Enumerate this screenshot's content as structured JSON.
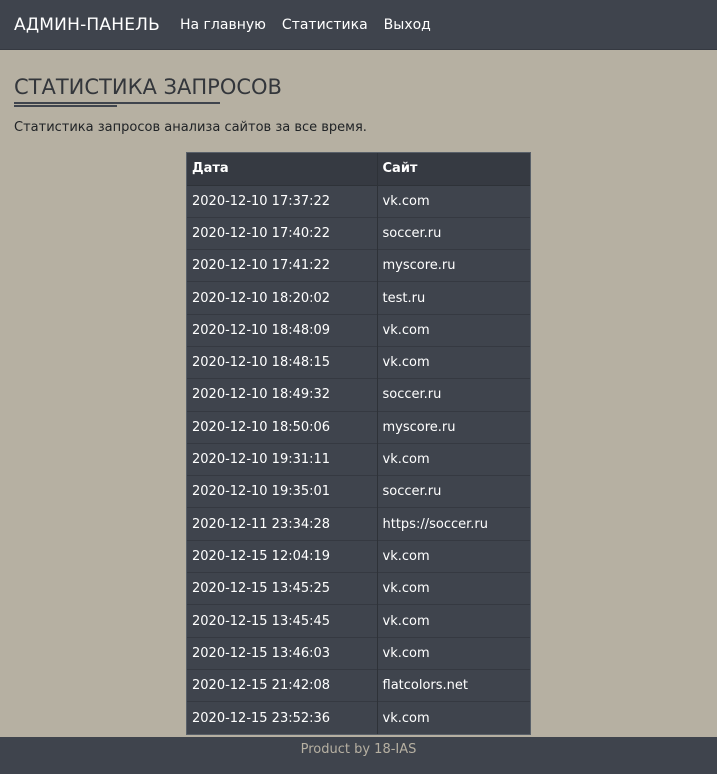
{
  "navbar": {
    "brand": "АДМИН-ПАНЕЛЬ",
    "links": [
      "На главную",
      "Статистика",
      "Выход"
    ]
  },
  "page": {
    "title": "СТАТИСТИКА ЗАПРОСОВ",
    "description": "Статистика запросов анализа сайтов за все время."
  },
  "table": {
    "headers": [
      "Дата",
      "Сайт"
    ],
    "rows": [
      [
        "2020-12-10 17:37:22",
        "vk.com"
      ],
      [
        "2020-12-10 17:40:22",
        "soccer.ru"
      ],
      [
        "2020-12-10 17:41:22",
        "myscore.ru"
      ],
      [
        "2020-12-10 18:20:02",
        "test.ru"
      ],
      [
        "2020-12-10 18:48:09",
        "vk.com"
      ],
      [
        "2020-12-10 18:48:15",
        "vk.com"
      ],
      [
        "2020-12-10 18:49:32",
        "soccer.ru"
      ],
      [
        "2020-12-10 18:50:06",
        "myscore.ru"
      ],
      [
        "2020-12-10 19:31:11",
        "vk.com"
      ],
      [
        "2020-12-10 19:35:01",
        "soccer.ru"
      ],
      [
        "2020-12-11 23:34:28",
        "https://soccer.ru"
      ],
      [
        "2020-12-15 12:04:19",
        "vk.com"
      ],
      [
        "2020-12-15 13:45:25",
        "vk.com"
      ],
      [
        "2020-12-15 13:45:45",
        "vk.com"
      ],
      [
        "2020-12-15 13:46:03",
        "vk.com"
      ],
      [
        "2020-12-15 21:42:08",
        "flatcolors.net"
      ],
      [
        "2020-12-15 23:52:36",
        "vk.com"
      ]
    ]
  },
  "footer": {
    "text": "Product by 18-IAS"
  },
  "colors": {
    "background": "#b6b0a2",
    "navbar": "#3f444d",
    "table": "#3f444d",
    "footer_text": "#b6b0a2"
  }
}
